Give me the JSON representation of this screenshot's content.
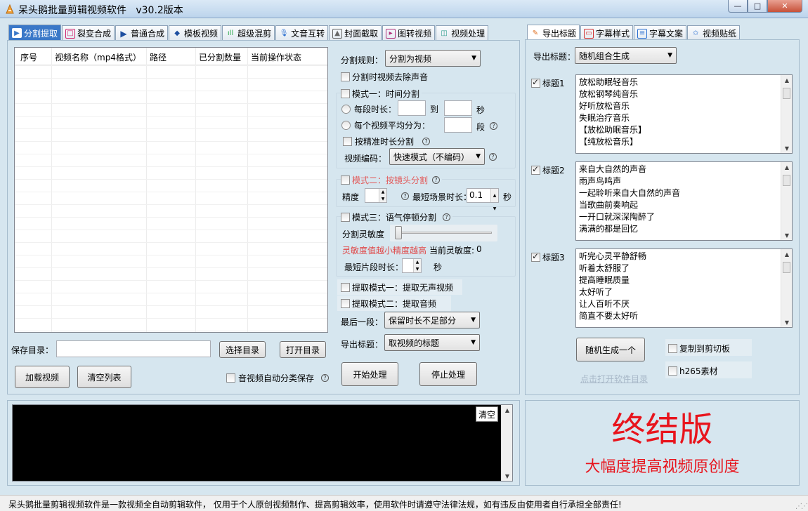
{
  "window": {
    "title": "呆头鹅批量剪辑视频软件   v30.2版本",
    "min_glyph": "—",
    "max_glyph": "□",
    "close_glyph": "✕"
  },
  "left_tabs": [
    {
      "label": "分割提取",
      "icon": "split-icon",
      "active": true
    },
    {
      "label": "裂变合成",
      "icon": "fission-icon"
    },
    {
      "label": "普通合成",
      "icon": "play-icon"
    },
    {
      "label": "模板视频",
      "icon": "template-icon"
    },
    {
      "label": "超级混剪",
      "icon": "waveform-icon"
    },
    {
      "label": "文音互转",
      "icon": "microphone-icon"
    },
    {
      "label": "封面截取",
      "icon": "image-icon"
    },
    {
      "label": "图转视频",
      "icon": "photo-video-icon"
    },
    {
      "label": "视频处理",
      "icon": "process-icon"
    }
  ],
  "right_tabs": [
    {
      "label": "导出标题",
      "icon": "export-title-icon",
      "active": true
    },
    {
      "label": "字幕样式",
      "icon": "subtitle-style-icon"
    },
    {
      "label": "字幕文案",
      "icon": "subtitle-text-icon"
    },
    {
      "label": "视频贴纸",
      "icon": "sticker-icon"
    }
  ],
  "table": {
    "columns": [
      "序号",
      "视频名称（mp4格式）",
      "路径",
      "已分割数量",
      "当前操作状态"
    ]
  },
  "save_dir": {
    "label": "保存目录：",
    "value": "",
    "choose_btn": "选择目录",
    "open_btn": "打开目录"
  },
  "bottom_left": {
    "load_btn": "加载视频",
    "clear_btn": "清空列表",
    "auto_classify_label": "音视频自动分类保存",
    "auto_classify_checked": false
  },
  "split": {
    "rule_label": "分割规则：",
    "rule_value": "分割为视频",
    "remove_audio_label": "分割时视频去除声音",
    "mode1": {
      "label": "模式一：时间分割",
      "seg_duration_label": "每段时长：",
      "to_label": "到",
      "sec_label": "秒",
      "avg_label": "每个视频平均分为：",
      "seg_label": "段",
      "precise_label": "按精准时长分割",
      "codec_label": "视频编码：",
      "codec_value": "快速模式（不编码）"
    },
    "mode2": {
      "label": "模式二：按镜头分割",
      "precision_label": "精度",
      "min_scene_label": "最短场景时长：",
      "min_scene_value": "0.1",
      "sec_label": "秒"
    },
    "mode3": {
      "label": "模式三：语气停顿分割",
      "sensitivity_label": "分割灵敏度",
      "hint": "灵敏度值越小精度越高",
      "current_label": "当前灵敏度:",
      "current_value": "0",
      "slider_level": 0,
      "min_clip_label": "最短片段时长：",
      "sec_label": "秒"
    },
    "extract1_label": "提取模式一：提取无声视频",
    "extract2_label": "提取模式二：提取音频",
    "last_seg_label": "最后一段：",
    "last_seg_value": "保留时长不足部分",
    "export_title_label": "导出标题：",
    "export_title_value": "取视频的标题",
    "start_btn": "开始处理",
    "stop_btn": "停止处理"
  },
  "right": {
    "export_label": "导出标题：",
    "export_value": "随机组合生成",
    "titles": [
      {
        "label": "标题1",
        "checked": true,
        "lines": [
          "放松助眠轻音乐",
          "放松钢琴纯音乐",
          "好听放松音乐",
          "失眠治疗音乐",
          "【放松助眠音乐】",
          "【纯放松音乐】"
        ]
      },
      {
        "label": "标题2",
        "checked": true,
        "lines": [
          "来自大自然的声音",
          "雨声鸟鸣声",
          "一起聆听来自大自然的声音",
          "当歌曲前奏响起",
          "一开口就深深陶醉了",
          "满满的都是回忆"
        ]
      },
      {
        "label": "标题3",
        "checked": true,
        "lines": [
          "听完心灵平静舒畅",
          "听着太舒服了",
          "提高睡眠质量",
          "太好听了",
          "让人百听不厌",
          "简直不要太好听"
        ]
      }
    ],
    "random_btn": "随机生成一个",
    "copy_label": "复制到剪切板",
    "h265_label": "h265素材",
    "open_dir_link": "点击打开软件目录"
  },
  "log": {
    "clear_btn": "清空"
  },
  "promo": {
    "headline": "终结版",
    "subline": "大幅度提高视频原创度",
    "color": "#e8141c"
  },
  "status_bar": {
    "text": "呆头鹅批量剪辑视频软件是一款视频全自动剪辑软件， 仅用于个人原创视频制作、提高剪辑效率，使用软件时请遵守法律法规，如有违反由使用者自行承担全部责任!"
  }
}
